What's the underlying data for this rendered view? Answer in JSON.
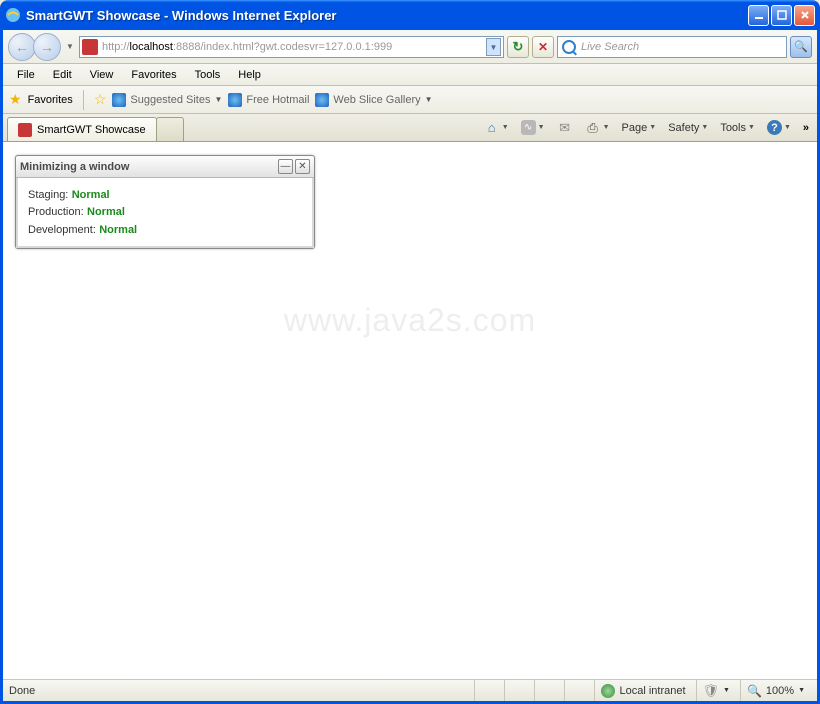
{
  "title": "SmartGWT Showcase - Windows Internet Explorer",
  "url": {
    "prefix": "http://",
    "host": "localhost",
    "rest": ":8888/index.html?gwt.codesvr=127.0.0.1:999"
  },
  "search_placeholder": "Live Search",
  "menus": [
    "File",
    "Edit",
    "View",
    "Favorites",
    "Tools",
    "Help"
  ],
  "favbar": {
    "label": "Favorites",
    "links": [
      "Suggested Sites",
      "Free Hotmail",
      "Web Slice Gallery"
    ]
  },
  "tab_title": "SmartGWT Showcase",
  "cmd": {
    "page": "Page",
    "safety": "Safety",
    "tools": "Tools"
  },
  "gwt": {
    "title": "Minimizing a window",
    "rows": [
      {
        "label": "Staging:",
        "status": "Normal"
      },
      {
        "label": "Production:",
        "status": "Normal"
      },
      {
        "label": "Development:",
        "status": "Normal"
      }
    ]
  },
  "watermark": "www.java2s.com",
  "status": {
    "done": "Done",
    "zone": "Local intranet",
    "zoom": "100%"
  }
}
